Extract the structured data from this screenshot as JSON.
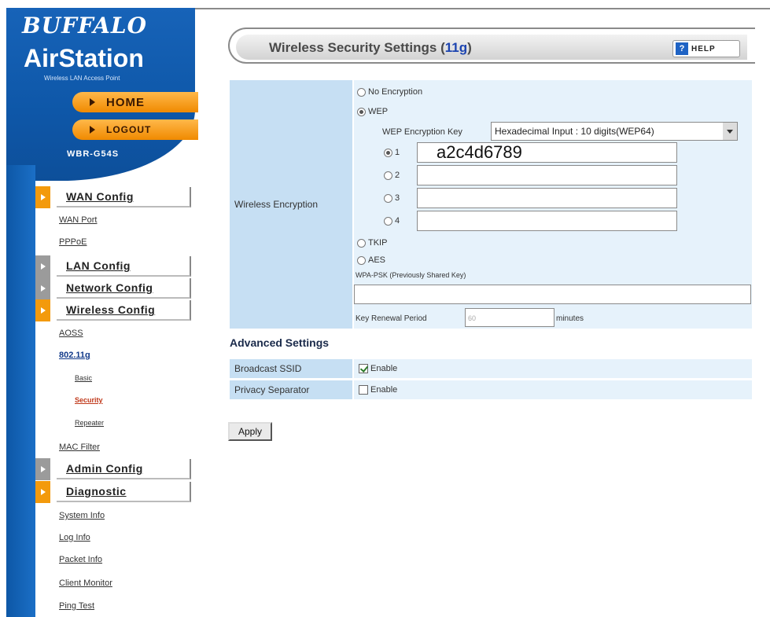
{
  "brand": {
    "company": "BUFFALO",
    "product": "AirStation",
    "tagline": "Wireless LAN Access Point",
    "model": "WBR-G54S"
  },
  "top_nav": {
    "home": "HOME",
    "logout": "LOGOUT"
  },
  "sidebar": {
    "sections": [
      {
        "label": "WAN Config",
        "color": "#f39a0c"
      },
      {
        "label": "LAN Config",
        "color": "#9b9b9b"
      },
      {
        "label": "Network Config",
        "color": "#9b9b9b"
      },
      {
        "label": "Wireless Config",
        "color": "#f39a0c"
      },
      {
        "label": "Admin Config",
        "color": "#9b9b9b"
      },
      {
        "label": "Diagnostic",
        "color": "#f39a0c"
      }
    ],
    "wan_links": [
      "WAN Port",
      "PPPoE"
    ],
    "wireless_links": [
      "AOSS",
      "802.11g"
    ],
    "wireless_sub_links": [
      "Basic",
      "Security",
      "Repeater"
    ],
    "wireless_links_after": [
      "MAC Filter"
    ],
    "diagnostic_links": [
      "System Info",
      "Log Info",
      "Packet Info",
      "Client Monitor",
      "Ping Test"
    ]
  },
  "header": {
    "title_prefix": "Wireless Security Settings (",
    "title_band": "11g",
    "title_suffix": ")",
    "help_label": "HELP",
    "help_icon_glyph": "?"
  },
  "wireless_encryption": {
    "label": "Wireless Encryption",
    "options": {
      "none": "No Encryption",
      "wep": "WEP",
      "tkip": "TKIP",
      "aes": "AES"
    },
    "selected": "wep",
    "wep_key_label": "WEP Encryption Key",
    "wep_key_type": "Hexadecimal Input : 10 digits(WEP64)",
    "keys": [
      {
        "index": "1",
        "value": "a2c4d6789",
        "selected": true
      },
      {
        "index": "2",
        "value": "",
        "selected": false
      },
      {
        "index": "3",
        "value": "",
        "selected": false
      },
      {
        "index": "4",
        "value": "",
        "selected": false
      }
    ],
    "wpa_psk_label": "WPA-PSK (Previously Shared Key)",
    "wpa_psk_value": "",
    "renewal_label": "Key Renewal Period",
    "renewal_value": "60",
    "renewal_unit": "minutes"
  },
  "advanced": {
    "title": "Advanced Settings",
    "broadcast_ssid_label": "Broadcast SSID",
    "broadcast_ssid_option": "Enable",
    "broadcast_ssid_checked": true,
    "privacy_label": "Privacy Separator",
    "privacy_option": "Enable",
    "privacy_checked": false
  },
  "apply_label": "Apply",
  "colors": {
    "brand_blue": "#1763b8",
    "accent_orange": "#f39a0c",
    "label_cell": "#c6dff3",
    "value_cell": "#e6f2fb",
    "title_band": "#1c44b0"
  }
}
